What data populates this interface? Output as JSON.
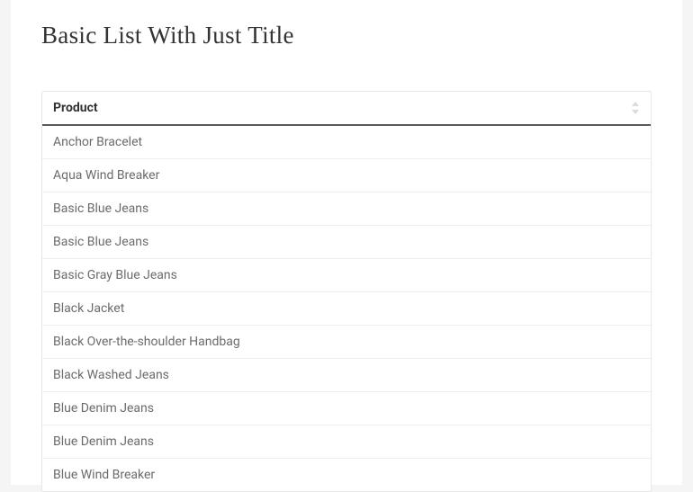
{
  "title": "Basic List With Just Title",
  "table": {
    "header": "Product",
    "rows": [
      "Anchor Bracelet",
      "Aqua Wind Breaker",
      "Basic Blue Jeans",
      "Basic Blue Jeans",
      "Basic Gray Blue Jeans",
      "Black Jacket",
      "Black Over-the-shoulder Handbag",
      "Black Washed Jeans",
      "Blue Denim Jeans",
      "Blue Denim Jeans",
      "Blue Wind Breaker"
    ]
  }
}
